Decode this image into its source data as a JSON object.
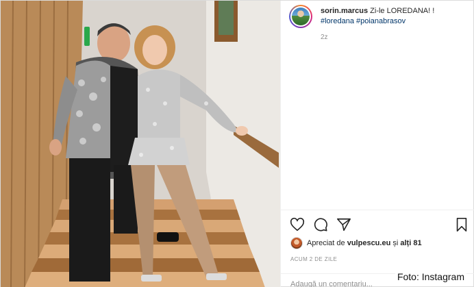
{
  "post": {
    "username": "sorin.marcus",
    "caption": "Zi-le LOREDANA! !",
    "hashtags": [
      "#loredana",
      "#poianabrasov"
    ],
    "time": "2z"
  },
  "actions": {
    "like_icon": "heart-icon",
    "comment_icon": "comment-icon",
    "share_icon": "share-icon",
    "save_icon": "bookmark-icon"
  },
  "likes": {
    "prefix": "Apreciat de",
    "user": "vulpescu.eu",
    "middle": "și",
    "others": "alți 81"
  },
  "timestamp": "ACUM 2 DE ZILE",
  "add_comment_placeholder": "Adaugă un comentariu...",
  "photo_credit": "Foto: Instagram",
  "colors": {
    "text": "#262626",
    "hashtag": "#003569",
    "muted": "#8e8e8e",
    "border": "#dbdbdb"
  }
}
